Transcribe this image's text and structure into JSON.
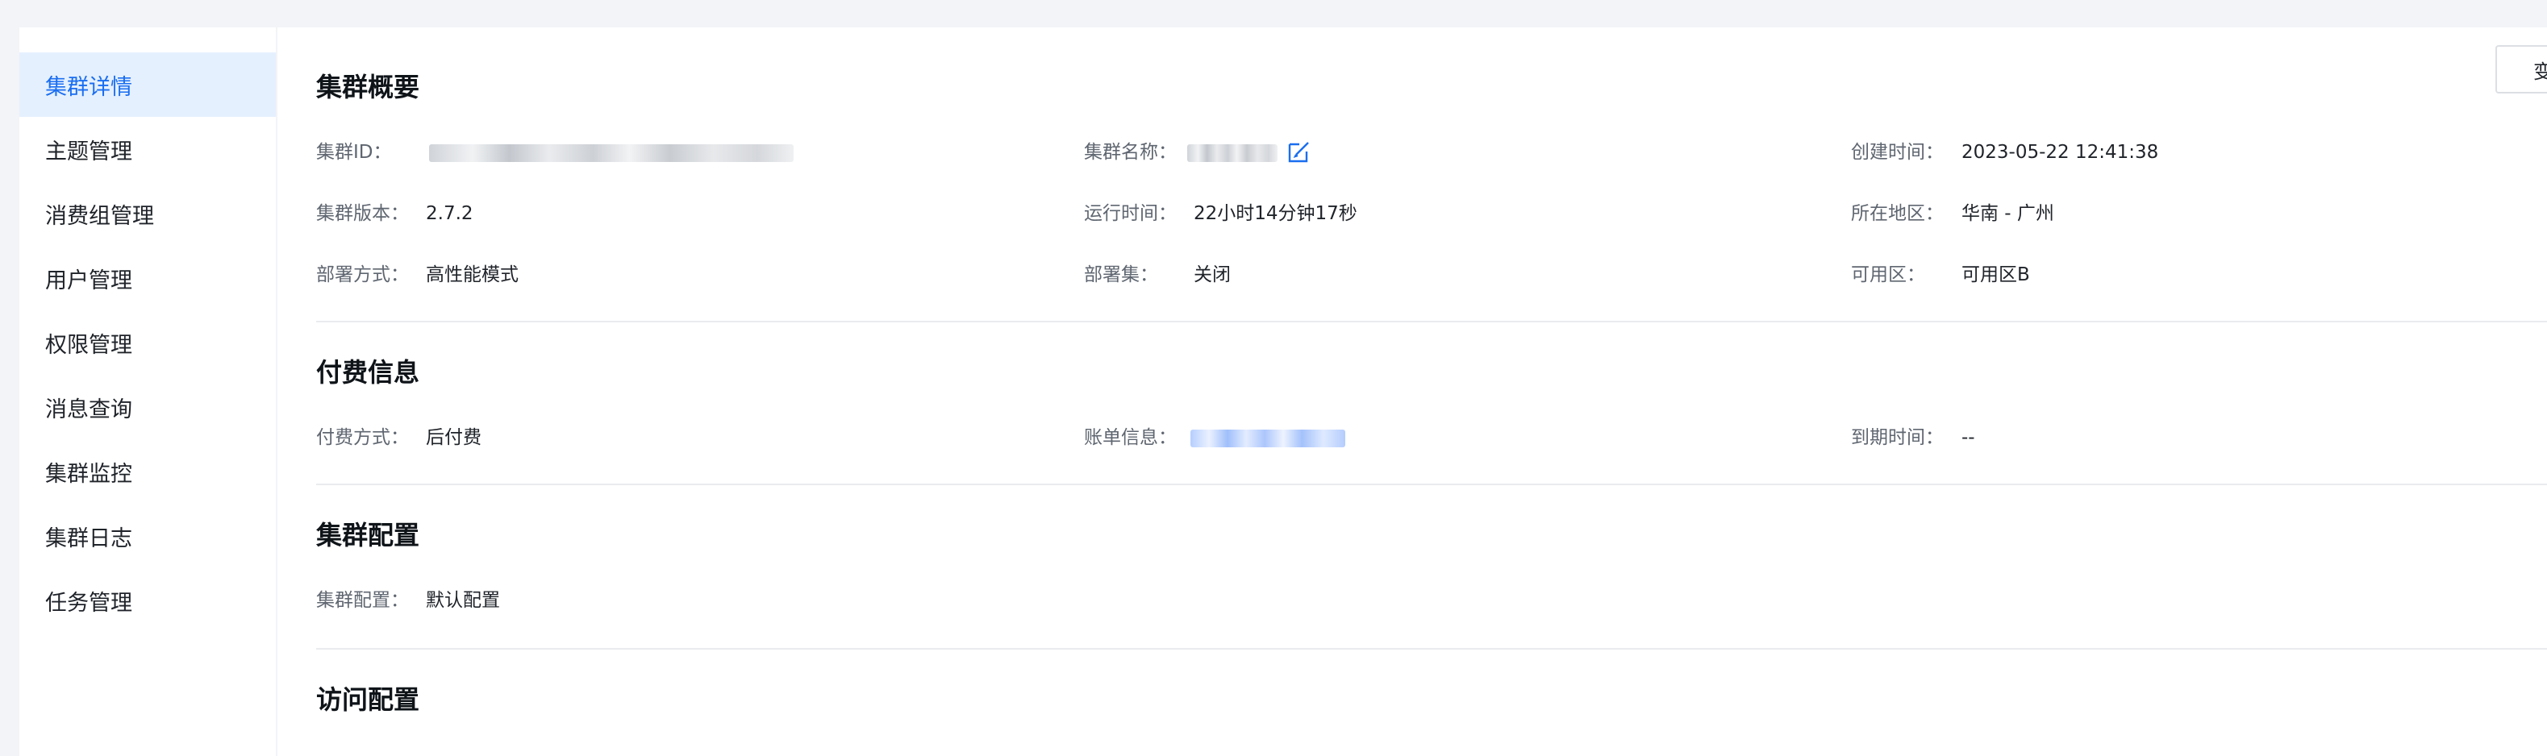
{
  "sidebar": {
    "items": [
      {
        "label": "集群详情",
        "active": true
      },
      {
        "label": "主题管理"
      },
      {
        "label": "消费组管理"
      },
      {
        "label": "用户管理"
      },
      {
        "label": "权限管理"
      },
      {
        "label": "消息查询"
      },
      {
        "label": "集群监控"
      },
      {
        "label": "集群日志"
      },
      {
        "label": "任务管理"
      }
    ]
  },
  "toolbar": {
    "change_label": "变"
  },
  "overview": {
    "title": "集群概要",
    "cluster_id_label": "集群ID：",
    "cluster_name_label": "集群名称：",
    "create_time_label": "创建时间：",
    "create_time": "2023-05-22 12:41:38",
    "version_label": "集群版本：",
    "version": "2.7.2",
    "run_time_label": "运行时间：",
    "run_time": "22小时14分钟17秒",
    "region_label": "所在地区：",
    "region": "华南 - 广州",
    "deploy_mode_label": "部署方式：",
    "deploy_mode": "高性能模式",
    "deploy_set_label": "部署集：",
    "deploy_set": "关闭",
    "zone_label": "可用区：",
    "zone": "可用区B"
  },
  "billing": {
    "title": "付费信息",
    "pay_mode_label": "付费方式：",
    "pay_mode": "后付费",
    "bill_label": "账单信息：",
    "expire_label": "到期时间：",
    "expire": "--"
  },
  "config": {
    "title": "集群配置",
    "config_label": "集群配置：",
    "config_value": "默认配置"
  },
  "access": {
    "title": "访问配置"
  },
  "colors": {
    "accent": "#1a6ef0",
    "active_bg": "#e5f0ff",
    "divider": "#e9ebee"
  }
}
